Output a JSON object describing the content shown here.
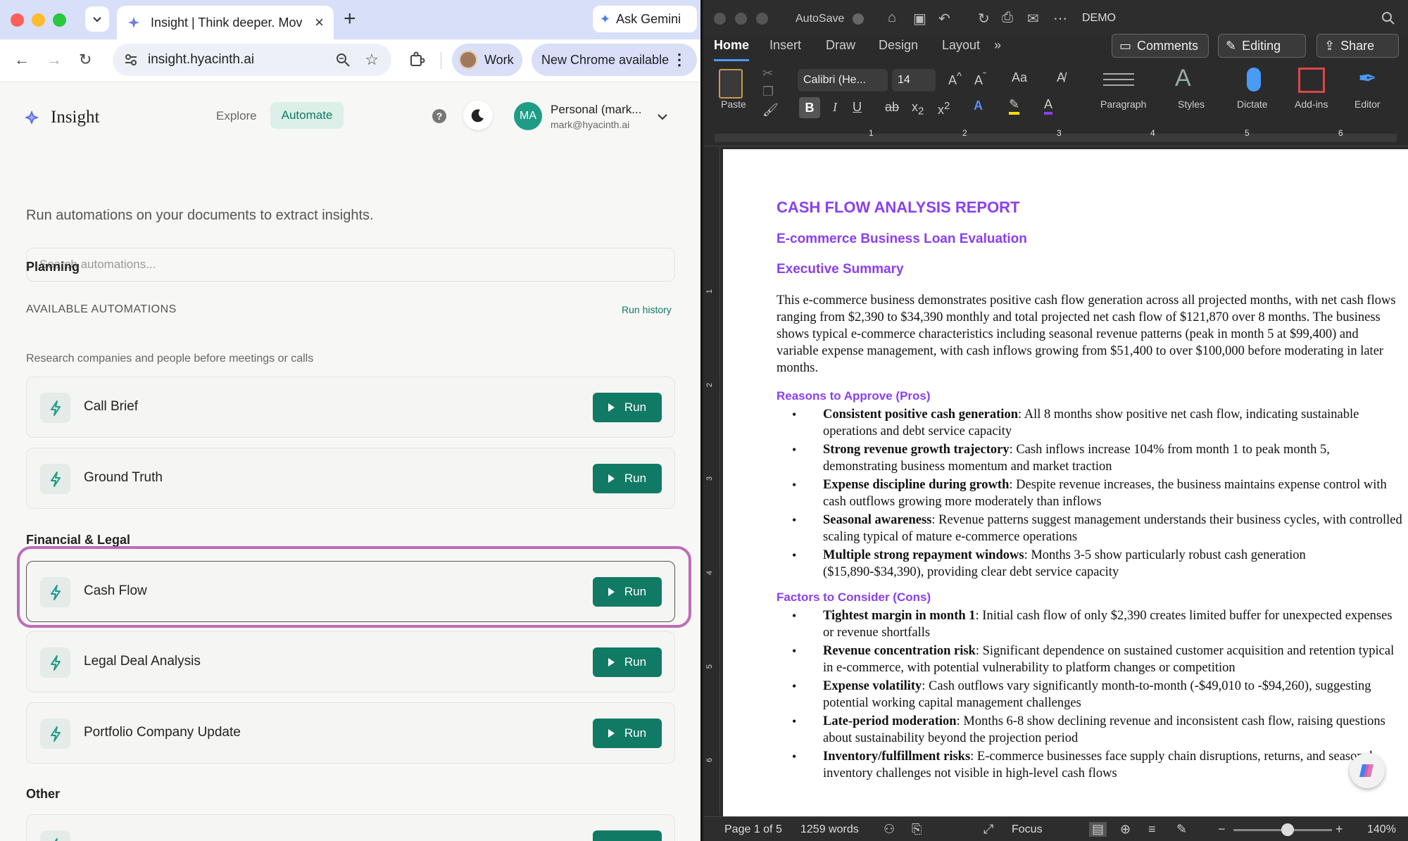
{
  "browser": {
    "tab_title": "Insight | Think deeper. Move f",
    "url": "insight.hyacinth.ai",
    "ask_gemini": "Ask Gemini",
    "profile_label": "Work",
    "update_label": "New Chrome available"
  },
  "app": {
    "name": "Insight",
    "nav": {
      "explore": "Explore",
      "automate": "Automate"
    },
    "help_icon_text": "?",
    "account": {
      "initials": "MA",
      "name": "Personal (mark...",
      "email": "mark@hyacinth.ai"
    },
    "intro": "Run automations on your documents to extract insights.",
    "search_placeholder": "Search automations...",
    "section_label": "AVAILABLE AUTOMATIONS",
    "run_history": "Run history",
    "run_label": "Run",
    "groups": [
      {
        "title": "Planning",
        "desc": "Research companies and people before meetings or calls",
        "items": [
          {
            "name": "Call Brief"
          },
          {
            "name": "Ground Truth"
          }
        ]
      },
      {
        "title": "Financial & Legal",
        "items": [
          {
            "name": "Cash Flow"
          },
          {
            "name": "Legal Deal Analysis"
          },
          {
            "name": "Portfolio Company Update"
          }
        ]
      },
      {
        "title": "Other"
      }
    ],
    "accent_color": "#117a65",
    "highlight_color": "#b454ad"
  },
  "word": {
    "autosave": "AutoSave",
    "doc_name": "DEMO",
    "tabs": [
      "Home",
      "Insert",
      "Draw",
      "Design",
      "Layout"
    ],
    "comments": "Comments",
    "editing": "Editing",
    "share": "Share",
    "ribbon": {
      "paste": "Paste",
      "font": "Calibri (He...",
      "size": "14",
      "paragraph": "Paragraph",
      "styles": "Styles",
      "dictate": "Dictate",
      "addins": "Add-ins",
      "editor": "Editor"
    },
    "ruler_marks": [
      "1",
      "2",
      "3",
      "4",
      "5",
      "6"
    ],
    "vruler_marks": [
      "1",
      "2",
      "3",
      "4",
      "5",
      "6"
    ],
    "status": {
      "page": "Page 1 of 5",
      "words": "1259 words",
      "focus": "Focus",
      "zoom": "140%"
    },
    "zoom_level": 0.55
  },
  "document": {
    "title": "CASH FLOW ANALYSIS REPORT",
    "subtitle": "E-commerce Business Loan Evaluation",
    "exec_heading": "Executive Summary",
    "exec_text": "This e-commerce business demonstrates positive cash flow generation across all projected months, with net cash flows ranging from $2,390 to $34,390 monthly and total projected net cash flow of $121,870 over 8 months. The business shows typical e-commerce characteristics including seasonal revenue patterns (peak in month 5 at $99,400) and variable expense management, with cash inflows growing from $51,400 to over $100,000 before moderating in later months.",
    "pros_heading": "Reasons to Approve (Pros)",
    "pros": [
      {
        "b": "Consistent positive cash generation",
        "t": ": All 8 months show positive net cash flow, indicating sustainable operations and debt service capacity"
      },
      {
        "b": "Strong revenue growth trajectory",
        "t": ": Cash inflows increase 104% from month 1 to peak month 5, demonstrating business momentum and market traction"
      },
      {
        "b": "Expense discipline during growth",
        "t": ": Despite revenue increases, the business maintains expense control with cash outflows growing more moderately than inflows"
      },
      {
        "b": "Seasonal awareness",
        "t": ": Revenue patterns suggest management understands their business cycles, with controlled scaling typical of mature e-commerce operations"
      },
      {
        "b": "Multiple strong repayment windows",
        "t": ": Months 3-5 show particularly robust cash generation ($15,890-$34,390), providing clear debt service capacity"
      }
    ],
    "cons_heading": "Factors to Consider (Cons)",
    "cons": [
      {
        "b": "Tightest margin in month 1",
        "t": ": Initial cash flow of only $2,390 creates limited buffer for unexpected expenses or revenue shortfalls"
      },
      {
        "b": "Revenue concentration risk",
        "t": ": Significant dependence on sustained customer acquisition and retention typical in e-commerce, with potential vulnerability to platform changes or competition"
      },
      {
        "b": "Expense volatility",
        "t": ": Cash outflows vary significantly month-to-month (-$49,010 to -$94,260), suggesting potential working capital management challenges"
      },
      {
        "b": "Late-period moderation",
        "t": ": Months 6-8 show declining revenue and inconsistent cash flow, raising questions about sustainability beyond the projection period"
      },
      {
        "b": "Inventory/fulfillment risks",
        "t": ": E-commerce businesses face supply chain disruptions, returns, and seasonal inventory challenges not visible in high-level cash flows"
      }
    ]
  }
}
